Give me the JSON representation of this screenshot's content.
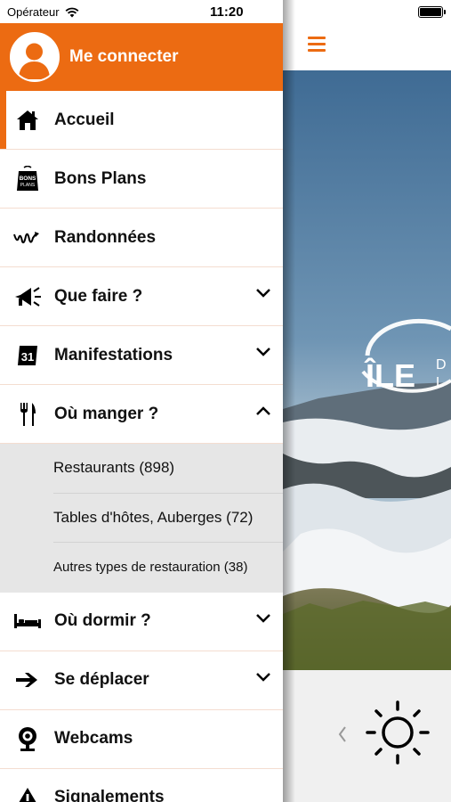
{
  "status_bar": {
    "carrier": "Opérateur",
    "time": "11:20",
    "battery_percent": 100
  },
  "menu": {
    "login_label": "Me connecter",
    "items": [
      {
        "label": "Accueil",
        "icon": "home-icon",
        "active": true,
        "chevron": "none"
      },
      {
        "label": "Bons Plans",
        "icon": "bons-plans-tag-icon",
        "chevron": "none"
      },
      {
        "label": "Randonnées",
        "icon": "hiking-trail-icon",
        "chevron": "none"
      },
      {
        "label": "Que faire ?",
        "icon": "megaphone-icon",
        "chevron": "down"
      },
      {
        "label": "Manifestations",
        "icon": "calendar-icon",
        "chevron": "down"
      },
      {
        "label": "Où manger ?",
        "icon": "fork-knife-icon",
        "chevron": "up",
        "expanded": true
      },
      {
        "label": "Où dormir ?",
        "icon": "bed-icon",
        "chevron": "down"
      },
      {
        "label": "Se déplacer",
        "icon": "arrow-right-icon",
        "chevron": "down"
      },
      {
        "label": "Webcams",
        "icon": "webcam-icon",
        "chevron": "none"
      },
      {
        "label": "Signalements",
        "icon": "warning-icon",
        "chevron": "none"
      }
    ],
    "submenu_ou_manger": [
      "Restaurants (898)",
      "Tables d'hôtes, Auberges (72)",
      "Autres types de restauration (38)"
    ],
    "bons_plans_tag_text": [
      "BONS",
      "PLANS"
    ],
    "calendar_day": "31"
  },
  "content": {
    "logo_text_big": "ÎLE",
    "logo_text_small": [
      "D",
      "L"
    ]
  },
  "colors": {
    "accent": "#ec6b12",
    "submenu_bg": "#e6e6e6",
    "separator": "#f4ddd0"
  }
}
